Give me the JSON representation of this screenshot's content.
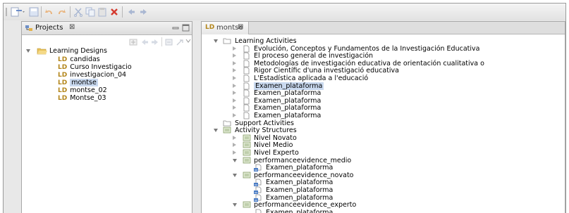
{
  "left_view": {
    "tab_label": "Projects",
    "tab_close": "⊠",
    "tree": {
      "root_label": "Learning Designs",
      "items": [
        {
          "prefix": "LD",
          "label": "candidas"
        },
        {
          "prefix": "LD",
          "label": "Curso Investigacio"
        },
        {
          "prefix": "LD",
          "label": "investigacion_04"
        },
        {
          "prefix": "LD",
          "label": "montse"
        },
        {
          "prefix": "LD",
          "label": "montse_02"
        },
        {
          "prefix": "LD",
          "label": "Montse_03"
        }
      ]
    }
  },
  "editor": {
    "tab_prefix": "LD",
    "tab_label": "montse",
    "tab_close": "⊠",
    "tree": {
      "learning_activities_label": "Learning Activities",
      "activities": [
        "Evolución, Conceptos y Fundamentos de la Investigación Educativa",
        "El proceso general de investigación",
        "Metodologías de investigación educativa de orientación cualitativa o",
        "Rigor Científic d'una investigació educativa",
        "L'Estadística aplicada a l'educació",
        "Examen_plataforma",
        "Examen_plataforma",
        "Examen_plataforma",
        "Examen_plataforma",
        "Examen_plataforma"
      ],
      "support_activities_label": "Support Activities",
      "activity_structures_label": "Activity Structures",
      "structures": [
        {
          "label": "Nivel Novato",
          "children": []
        },
        {
          "label": "Nivel Medio",
          "children": []
        },
        {
          "label": "Nivel Experto",
          "children": []
        },
        {
          "label": "performanceevidence_medio",
          "children": [
            "Examen_plataforma"
          ]
        },
        {
          "label": "performanceevidence_novato",
          "children": [
            "Examen_plataforma",
            "Examen_plataforma",
            "Examen_plataforma"
          ]
        },
        {
          "label": "performanceevidence_experto",
          "children": [
            "Examen_plataforma"
          ]
        }
      ]
    }
  },
  "colors": {
    "selection": "#c9d9ef",
    "ld_prefix": "#b3861b",
    "folder": "#e8c25a"
  }
}
